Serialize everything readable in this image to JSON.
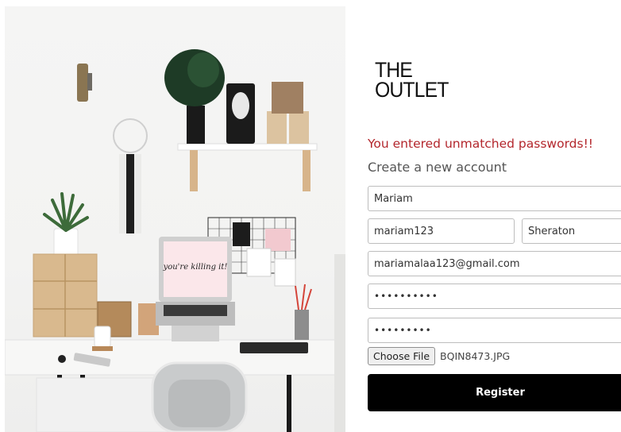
{
  "logo": {
    "line1": "THE",
    "line2": "OUTLET"
  },
  "photo": {
    "laptop_screen_text": "you're killing it!"
  },
  "form": {
    "error_message": "You entered unmatched passwords!!",
    "subtitle": "Create a new account",
    "name_value": "Mariam",
    "username_value": "mariam123",
    "branch_selected": "Sheraton",
    "email_value": "mariamalaa123@gmail.com",
    "password_value": "••••••••••",
    "confirm_password_value": "•••••••••",
    "file_button_label": "Choose File",
    "file_name": "BQIN8473.JPG",
    "submit_label": "Register"
  },
  "colors": {
    "error": "#b3262c",
    "button_bg": "#000000",
    "button_text": "#ffffff"
  }
}
